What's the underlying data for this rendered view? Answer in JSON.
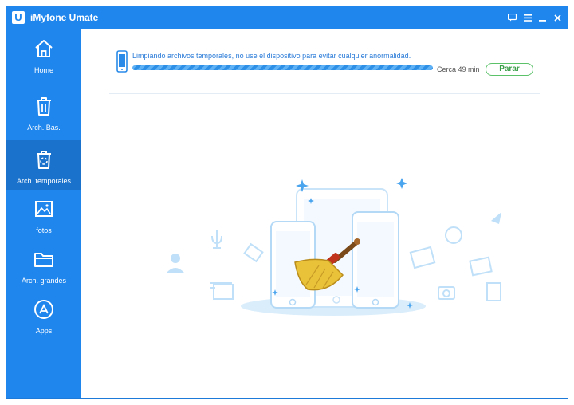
{
  "app": {
    "title": "iMyfone Umate",
    "logo_letter": "U"
  },
  "window_controls": [
    "feedback-icon",
    "menu-icon",
    "minimize-icon",
    "close-icon"
  ],
  "sidebar": {
    "items": [
      {
        "label": "Home",
        "icon": "home-icon",
        "active": false
      },
      {
        "label": "Arch. Bas.",
        "icon": "trash-icon",
        "active": false
      },
      {
        "label": "Arch. temporales",
        "icon": "temp-files-icon",
        "active": true
      },
      {
        "label": "fotos",
        "icon": "photo-icon",
        "active": false
      },
      {
        "label": "Arch. grandes",
        "icon": "folder-icon",
        "active": false
      },
      {
        "label": "Apps",
        "icon": "app-store-icon",
        "active": false
      }
    ]
  },
  "main": {
    "status_text": "Limpiando archivos temporales, no use el dispositivo para evitar cualquier anormalidad.",
    "eta": "Cerca 49 min",
    "stop_label": "Parar"
  },
  "colors": {
    "accent": "#1f86ee",
    "active": "#1a72cc",
    "stop": "#3a9e49"
  }
}
